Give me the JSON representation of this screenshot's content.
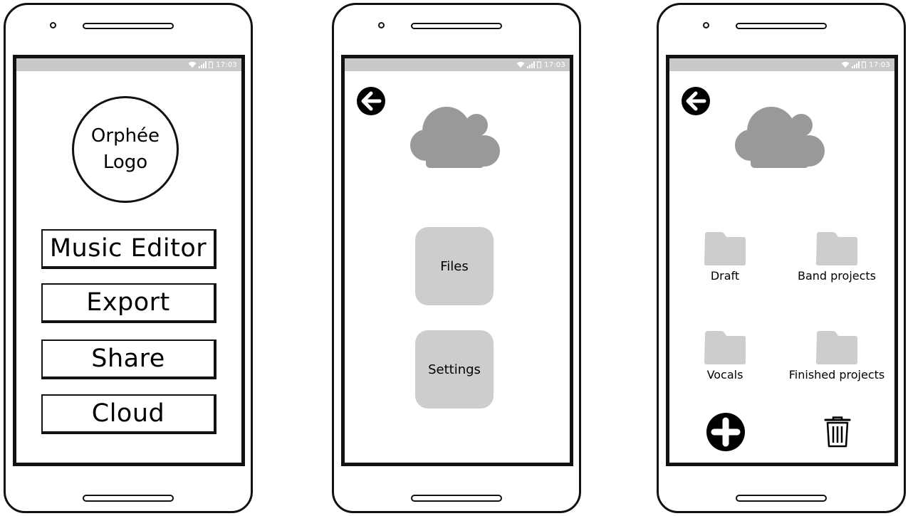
{
  "status_bar": {
    "time": "17:03"
  },
  "screen1": {
    "logo_line1": "Orphée",
    "logo_line2": "Logo",
    "buttons": [
      "Music Editor",
      "Export",
      "Share",
      "Cloud"
    ]
  },
  "screen2": {
    "tiles": [
      "Files",
      "Settings"
    ]
  },
  "screen3": {
    "folders": [
      "Draft",
      "Band projects",
      "Vocals",
      "Finished projects"
    ]
  },
  "icons": {
    "back": "back-arrow-icon",
    "cloud": "cloud-icon",
    "folder": "folder-icon",
    "add": "plus-circle-icon",
    "trash": "trash-icon"
  },
  "colors": {
    "frame": "#111111",
    "status_bar": "#c9c9c9",
    "cloud": "#999999",
    "tile": "#cdcdcd"
  }
}
